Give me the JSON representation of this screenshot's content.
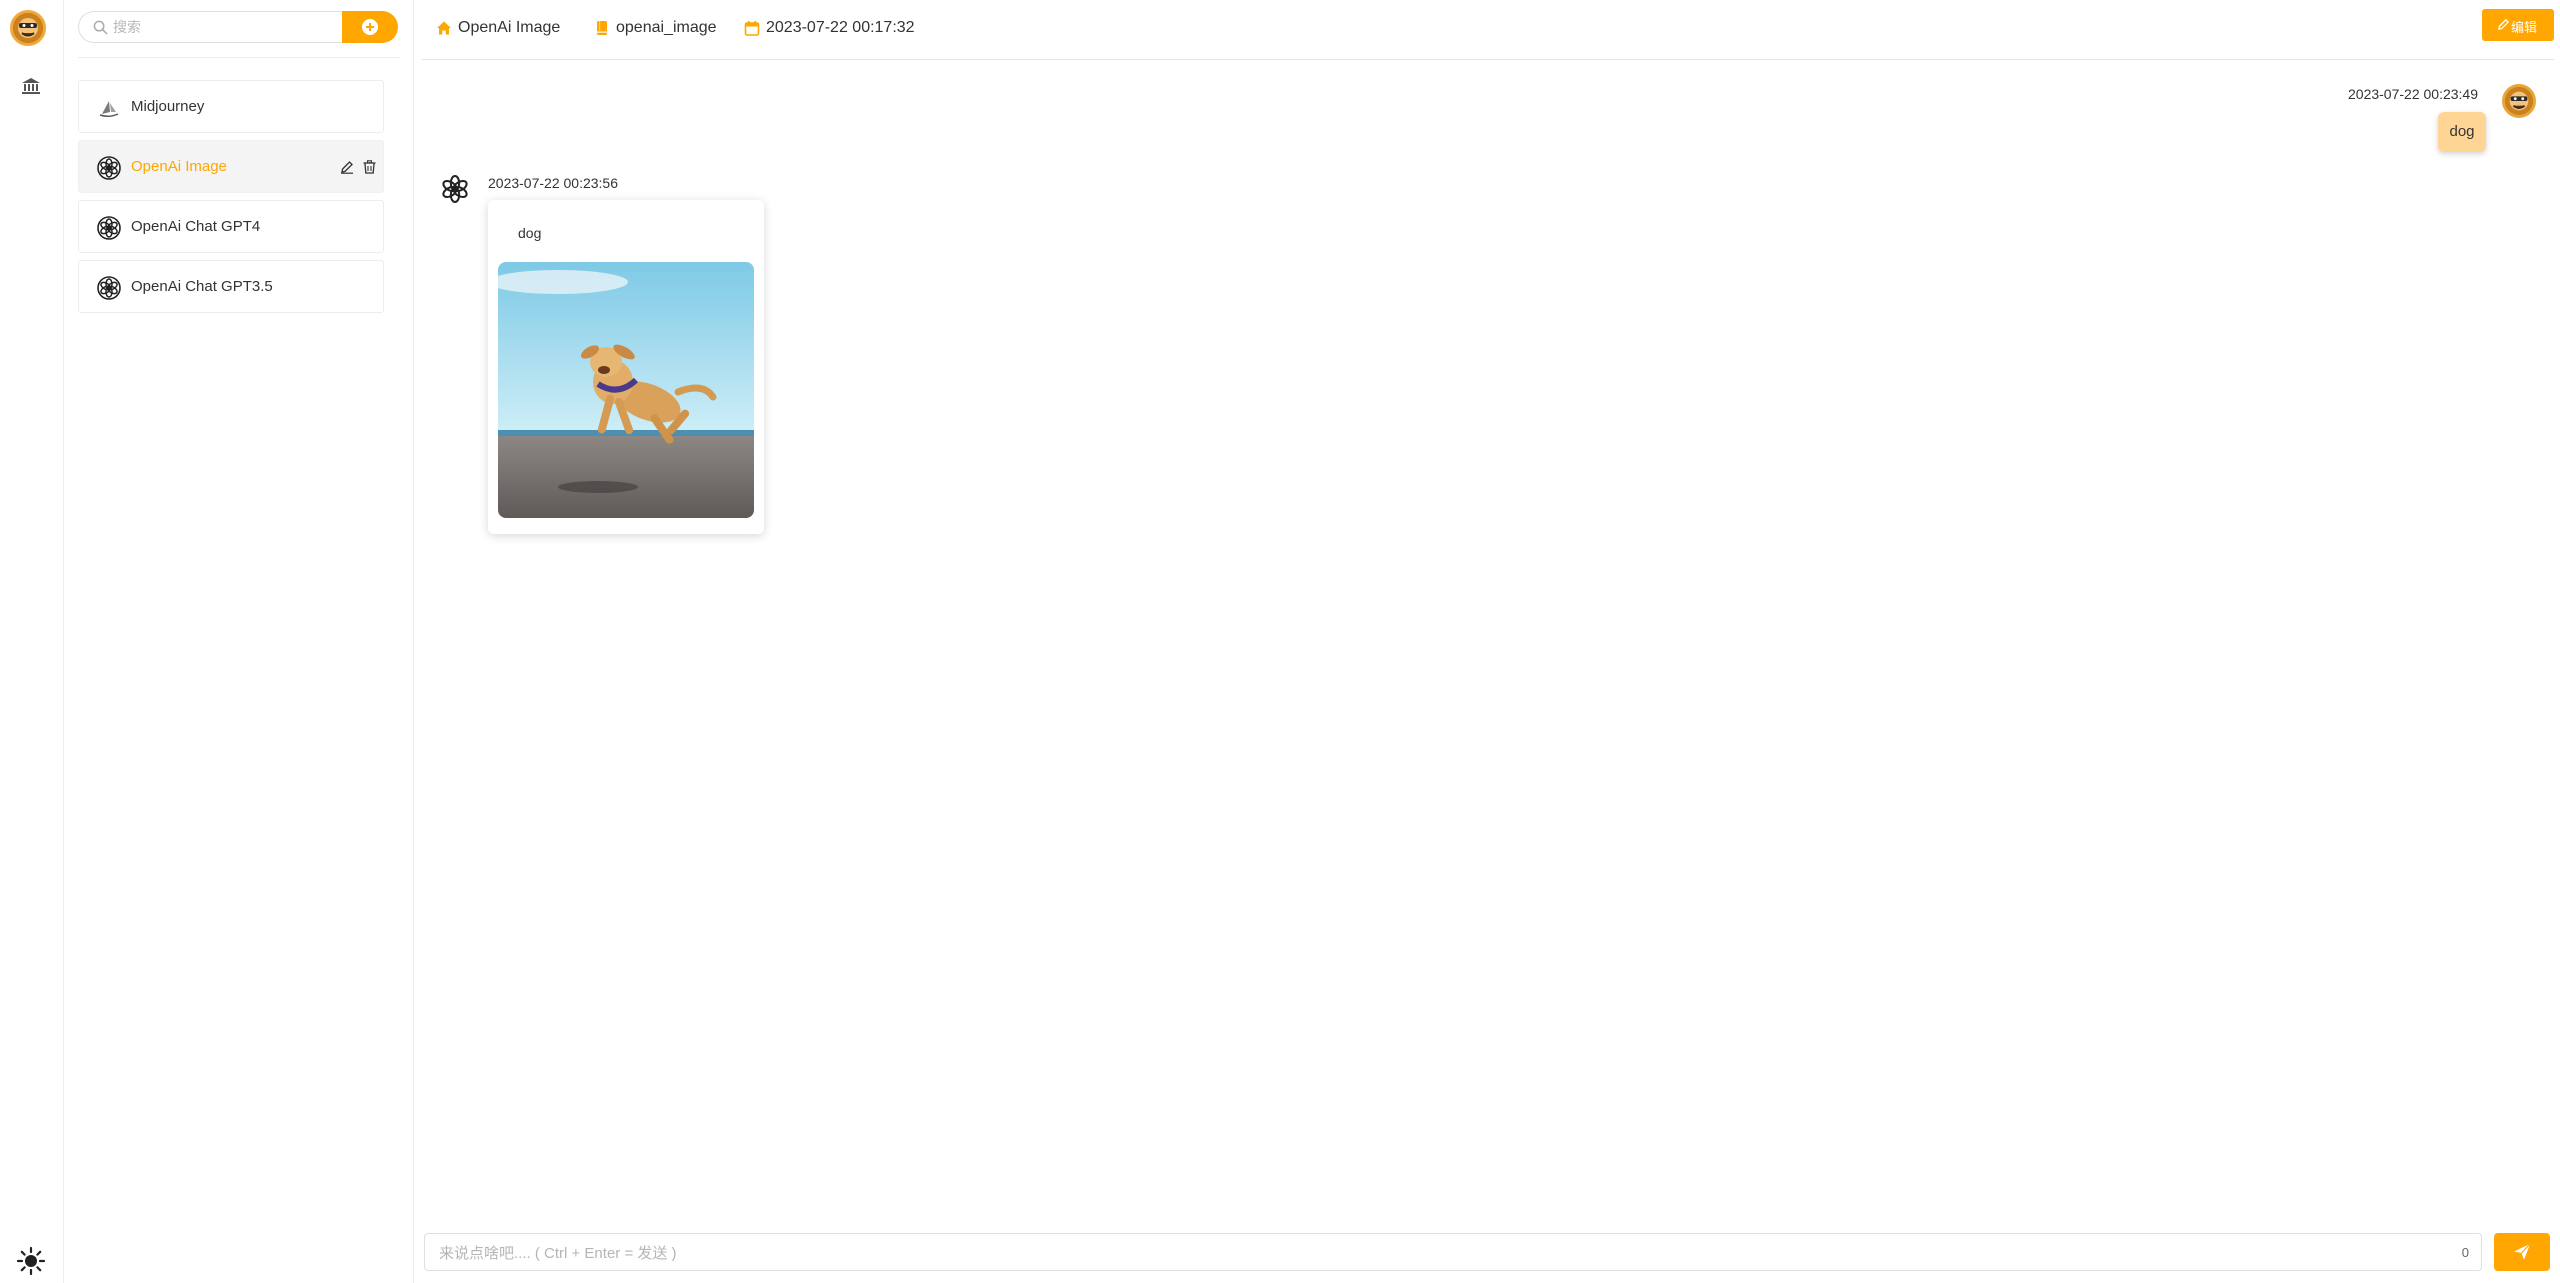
{
  "search": {
    "placeholder": "搜索"
  },
  "sessions": [
    {
      "label": "Midjourney",
      "icon": "midjourney-icon",
      "active": false
    },
    {
      "label": "OpenAi Image",
      "icon": "openai-icon",
      "active": true
    },
    {
      "label": "OpenAi Chat GPT4",
      "icon": "openai-icon",
      "active": false
    },
    {
      "label": "OpenAi Chat GPT3.5",
      "icon": "openai-icon",
      "active": false
    }
  ],
  "header": {
    "title": "OpenAi Image",
    "model": "openai_image",
    "created": "2023-07-22 00:17:32",
    "edit_label": "编辑"
  },
  "messages": {
    "user": {
      "time": "2023-07-22 00:23:49",
      "text": "dog"
    },
    "bot": {
      "time": "2023-07-22 00:23:56",
      "prompt": "dog",
      "image": "dog-running-on-beach"
    }
  },
  "composer": {
    "placeholder": "来说点啥吧.... ( Ctrl + Enter = 发送 )",
    "char_count": "0"
  },
  "colors": {
    "accent": "#ffa600",
    "user_bubble": "#ffd596"
  }
}
